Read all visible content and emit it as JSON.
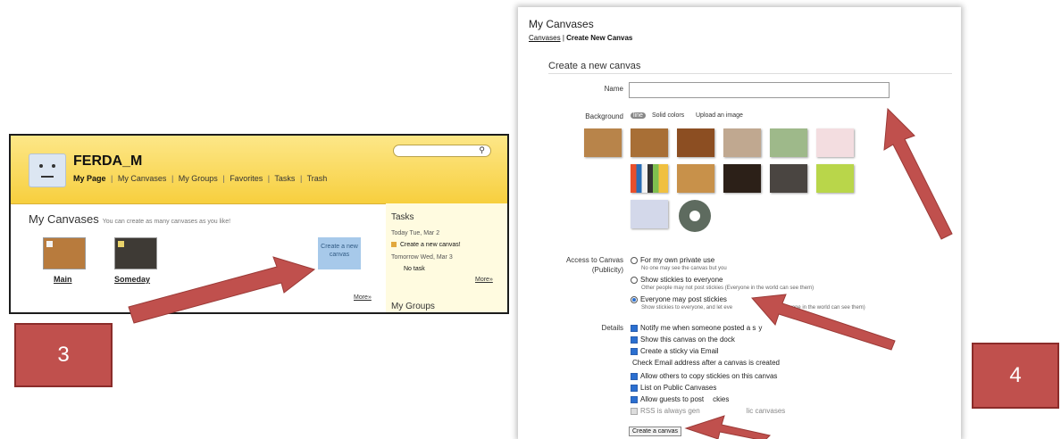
{
  "left_screen": {
    "search": {
      "placeholder": "",
      "icon": "search-icon"
    },
    "username": "FERDA_M",
    "nav": {
      "my_page": "My Page",
      "sep": "|",
      "my_canvases": "My Canvases",
      "my_groups": "My Groups",
      "favorites": "Favorites",
      "tasks": "Tasks",
      "trash": "Trash"
    },
    "canvases_title": "My Canvases",
    "canvases_hint": "You can create as many canvases as you like!",
    "canvases": [
      {
        "label": "Main"
      },
      {
        "label": "Someday"
      }
    ],
    "create_button": "Create a new canvas",
    "more": "More»",
    "tasks": {
      "title": "Tasks",
      "today": "Today Tue, Mar 2",
      "today_item": "Create a new canvas!",
      "tomorrow": "Tomorrow Wed, Mar 3",
      "tomorrow_item": "No task",
      "more": "More»"
    },
    "groups_title": "My Groups"
  },
  "right_screen": {
    "title": "My Canvases",
    "breadcrumb": {
      "link": "Canvases",
      "sep": "|",
      "current": "Create New Canvas"
    },
    "section_title": "Create a new canvas",
    "name_label": "Name",
    "name_value": "",
    "background_label": "Background",
    "background_tabs": [
      "line",
      "Solid colors",
      "Upload an image"
    ],
    "swatch_colors": [
      "#b8844a",
      "#a86f36",
      "#8c4e22",
      "#c0a890",
      "#9eb98a",
      "#f3dde0",
      "stripes",
      "#c8914a",
      "#2c2018",
      "#4a4541",
      "#b9d64a",
      "#d3d8ea",
      "gear"
    ],
    "access_label": "Access to Canvas",
    "access_label2": "(Publicity)",
    "access_options": [
      {
        "label": "For my own private use",
        "desc": "No one may see the canvas but you",
        "selected": false
      },
      {
        "label": "Show stickies to everyone",
        "desc": "Other people may not post stickies (Everyone in the world can see them)",
        "selected": false
      },
      {
        "label": "Everyone may post stickies",
        "desc": "Show stickies to everyone, and let eve",
        "desc_tail": "ckies (Everyone in the world can see them)",
        "selected": true
      }
    ],
    "details_label": "Details",
    "details": [
      {
        "label": "Notify me when someone posted a s",
        "tail": "y",
        "checked": true
      },
      {
        "label": "Show this canvas on the dock",
        "checked": true
      },
      {
        "label": "Create a sticky via Email",
        "checked": true
      },
      {
        "label": "Check Email address after a canvas is created",
        "plain": true
      },
      {
        "label": "Allow others to copy stickies on this canvas",
        "checked": true
      },
      {
        "label": "List on Public Canvases",
        "checked": true
      },
      {
        "label": "Allow guests to post",
        "tail": "ckies",
        "checked": true
      },
      {
        "label": "RSS is always gen",
        "tail": "lic canvases",
        "checked": false,
        "disabled": true
      }
    ],
    "submit": "Create a canvas"
  },
  "steps": [
    "3",
    "4"
  ],
  "colors": {
    "arrow": "#c0504d",
    "step_box": "#c0504d",
    "header_yellow": "#f7cf3e"
  }
}
